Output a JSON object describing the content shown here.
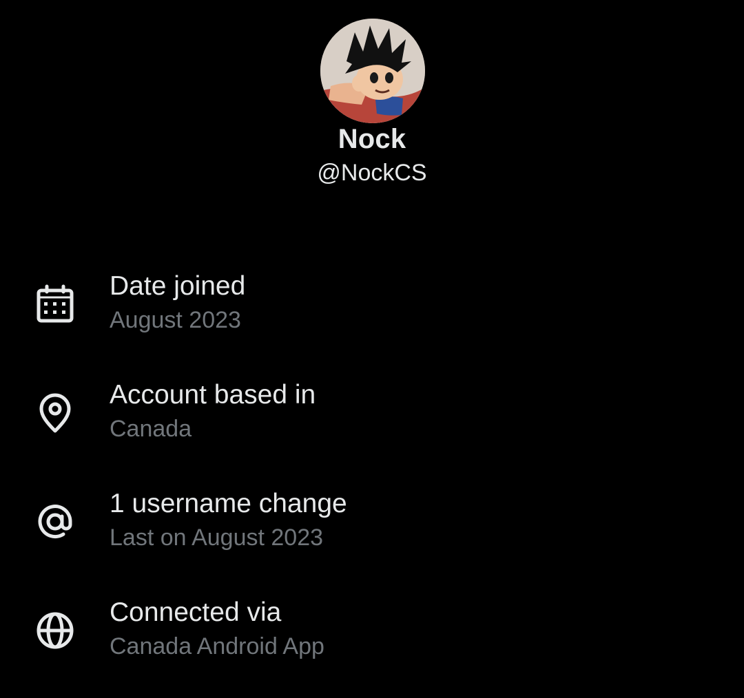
{
  "profile": {
    "display_name": "Nock",
    "handle": "@NockCS",
    "avatar_icon": "avatar-image"
  },
  "info": [
    {
      "icon": "calendar-icon",
      "title": "Date joined",
      "value": "August 2023"
    },
    {
      "icon": "location-pin-icon",
      "title": "Account based in",
      "value": "Canada"
    },
    {
      "icon": "at-sign-icon",
      "title": "1 username change",
      "value": "Last on August 2023"
    },
    {
      "icon": "globe-icon",
      "title": "Connected via",
      "value": "Canada Android App"
    }
  ],
  "colors": {
    "background": "#000000",
    "primary_text": "#e7e9ea",
    "secondary_text": "#71767b"
  }
}
